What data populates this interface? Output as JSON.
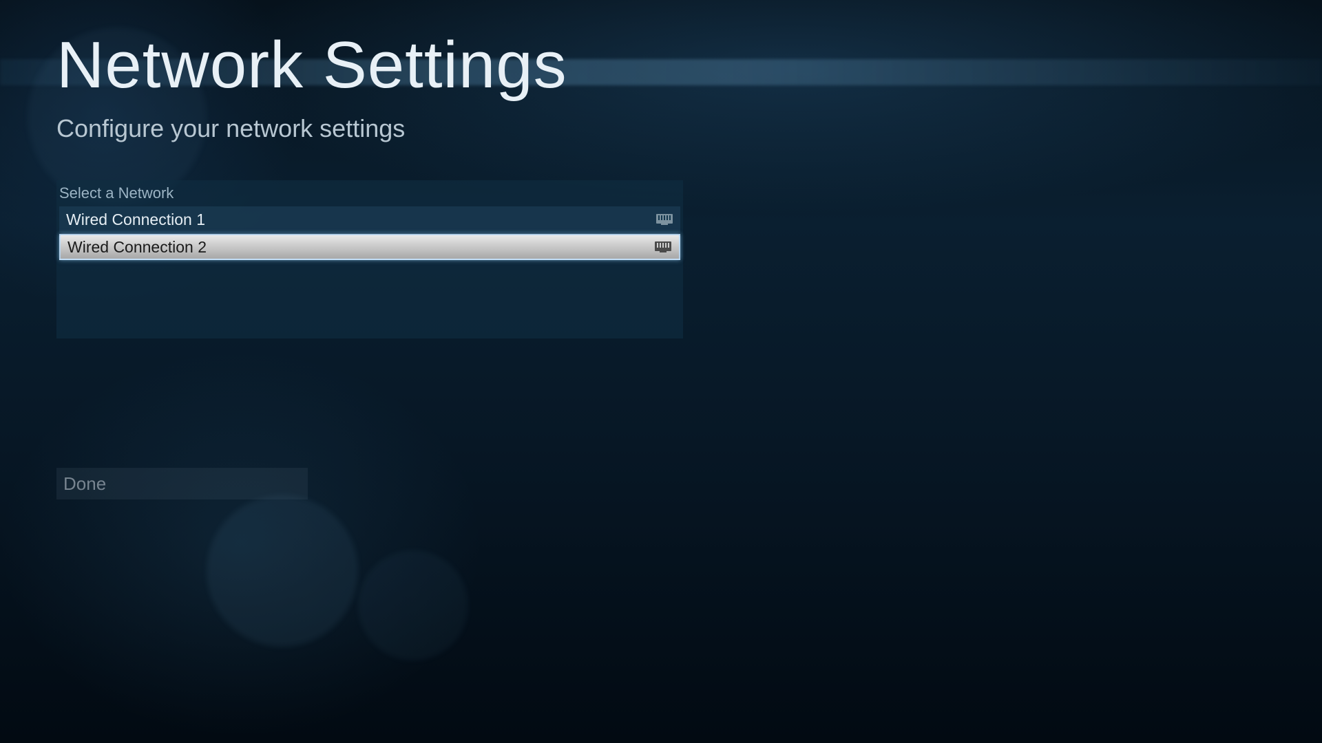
{
  "title": "Network Settings",
  "subtitle": "Configure your network settings",
  "panel": {
    "header": "Select a Network",
    "networks": [
      {
        "label": "Wired Connection 1",
        "selected": false,
        "type": "wired"
      },
      {
        "label": "Wired Connection 2",
        "selected": true,
        "type": "wired"
      }
    ]
  },
  "done_label": "Done"
}
